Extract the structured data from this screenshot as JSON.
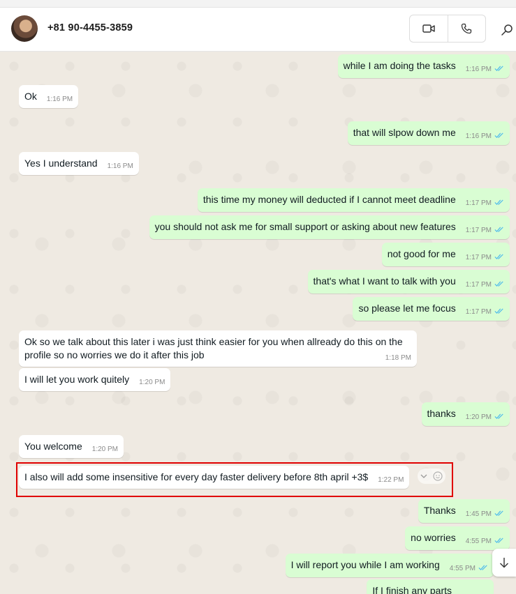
{
  "header": {
    "contact_name": "+81 90-4455-3859",
    "icons": {
      "video": "video-call-icon",
      "voice": "voice-call-icon",
      "search": "search-icon"
    }
  },
  "colors": {
    "outgoing_bubble": "#d9fdd3",
    "incoming_bubble": "#ffffff",
    "read_ticks": "#53bdeb",
    "highlight_border": "#e00000"
  },
  "messages": [
    {
      "dir": "out",
      "text": "while I am doing the tasks",
      "time": "1:16 PM"
    },
    {
      "dir": "in",
      "text": "Ok",
      "time": "1:16 PM"
    },
    {
      "dir": "out",
      "text": "that will slpow down me",
      "time": "1:16 PM"
    },
    {
      "dir": "in",
      "text": "Yes I understand",
      "time": "1:16 PM"
    },
    {
      "dir": "out",
      "text": "this time my money will deducted if I cannot meet deadline",
      "time": "1:17 PM"
    },
    {
      "dir": "out",
      "text": "you should not ask me for small support or asking about new features",
      "time": "1:17 PM"
    },
    {
      "dir": "out",
      "text": "not good for me",
      "time": "1:17 PM"
    },
    {
      "dir": "out",
      "text": "that's what I want to talk with you",
      "time": "1:17 PM"
    },
    {
      "dir": "out",
      "text": "so please let me focus",
      "time": "1:17 PM"
    },
    {
      "dir": "in",
      "text": "Ok so we talk about this later i was just think easier for you when allready do this on the profile so no worries we do it after this job",
      "time": "1:18 PM"
    },
    {
      "dir": "in",
      "text": "I will let you work quitely",
      "time": "1:20 PM"
    },
    {
      "dir": "out",
      "text": "thanks",
      "time": "1:20 PM"
    },
    {
      "dir": "in",
      "text": "You welcome",
      "time": "1:20 PM"
    },
    {
      "dir": "in",
      "text": "I also will add some insensitive for every day faster delivery before 8th april +3$",
      "time": "1:22 PM"
    },
    {
      "dir": "out",
      "text": "Thanks",
      "time": "1:45 PM"
    },
    {
      "dir": "out",
      "text": "no worries",
      "time": "4:55 PM"
    },
    {
      "dir": "out",
      "text": "I will report you while I am working",
      "time": "4:55 PM"
    },
    {
      "dir": "out",
      "text": "If I finish any parts",
      "time": ""
    }
  ]
}
